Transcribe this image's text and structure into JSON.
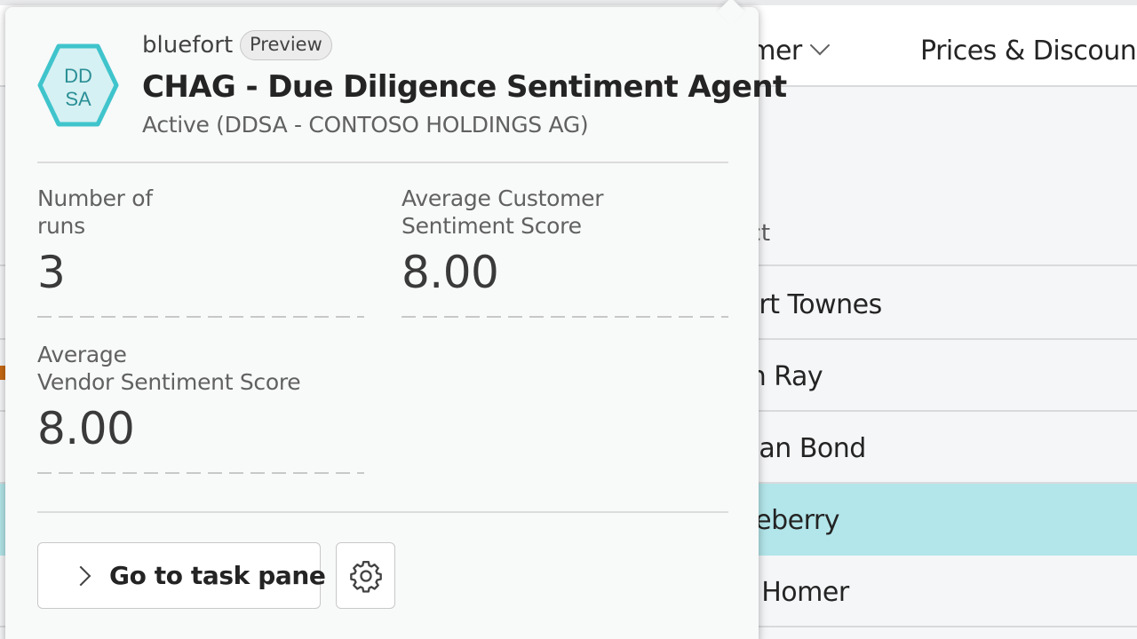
{
  "background": {
    "menu": {
      "customer_label": "stomer",
      "prices_label": "Prices & Discounts"
    },
    "list": {
      "column_header": "ntact",
      "rows": [
        {
          "contact": "obert Townes",
          "selected": false
        },
        {
          "contact": "elen Ray",
          "selected": false
        },
        {
          "contact": "eagan Bond",
          "selected": false
        },
        {
          "contact": "n Deberry",
          "selected": true
        },
        {
          "contact": "sse Homer",
          "selected": false
        }
      ]
    }
  },
  "agent_card": {
    "icon": {
      "name": "agent-hexagon-icon",
      "line1": "DD",
      "line2": "SA",
      "color": "#40c4cc"
    },
    "publisher": "bluefort",
    "badge": "Preview",
    "title": "CHAG - Due Diligence Sentiment Agent",
    "status": "Active (DDSA - CONTOSO HOLDINGS AG)",
    "kpis": [
      {
        "label_line1": "Number of",
        "label_line2": "runs",
        "value": "3"
      },
      {
        "label_line1": "Average Customer",
        "label_line2": "Sentiment Score",
        "value": "8.00"
      },
      {
        "label_line1": "Average",
        "label_line2": "Vendor Sentiment Score",
        "value": "8.00"
      }
    ],
    "actions": {
      "go_label": "Go to task pane",
      "go_icon": "chevron-right-icon",
      "settings_icon": "gear-icon"
    }
  },
  "colors": {
    "selected_row": "#b3e6ea",
    "accent": "#40c4cc"
  }
}
